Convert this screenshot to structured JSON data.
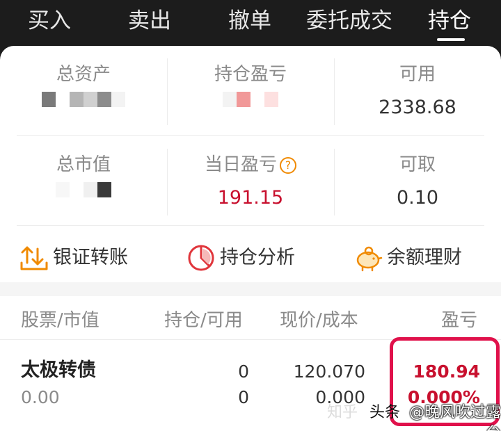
{
  "tabs": [
    {
      "label": "买入"
    },
    {
      "label": "卖出"
    },
    {
      "label": "撤单"
    },
    {
      "label": "委托成交"
    },
    {
      "label": "持仓"
    }
  ],
  "summary": {
    "total_assets": {
      "label": "总资产",
      "value": ""
    },
    "position_pl": {
      "label": "持仓盈亏",
      "value": ""
    },
    "available": {
      "label": "可用",
      "value": "2338.68"
    },
    "market_value": {
      "label": "总市值",
      "value": ""
    },
    "today_pl": {
      "label": "当日盈亏",
      "value": "191.15"
    },
    "withdrawable": {
      "label": "可取",
      "value": "0.10"
    }
  },
  "actions": [
    {
      "label": "银证转账",
      "icon": "transfer-icon"
    },
    {
      "label": "持仓分析",
      "icon": "pie-chart-icon"
    },
    {
      "label": "余额理财",
      "icon": "piggy-bank-icon"
    }
  ],
  "table": {
    "headers": [
      "股票/市值",
      "持仓/可用",
      "现价/成本",
      "盈亏"
    ],
    "rows": [
      {
        "name": "太极转债",
        "market_value": "0.00",
        "position": "0",
        "available": "0",
        "price": "120.070",
        "cost": "0.000",
        "pl_amount": "180.94",
        "pl_percent": "0.000%"
      }
    ]
  },
  "watermark": {
    "site": "知乎",
    "author": "@晚风吹过露台",
    "source": "头条"
  },
  "colors": {
    "profit_red": "#c8102e",
    "accent_orange": "#f08a00",
    "highlight_pink": "#e0114b",
    "nav_bg": "#1c1c1c"
  }
}
